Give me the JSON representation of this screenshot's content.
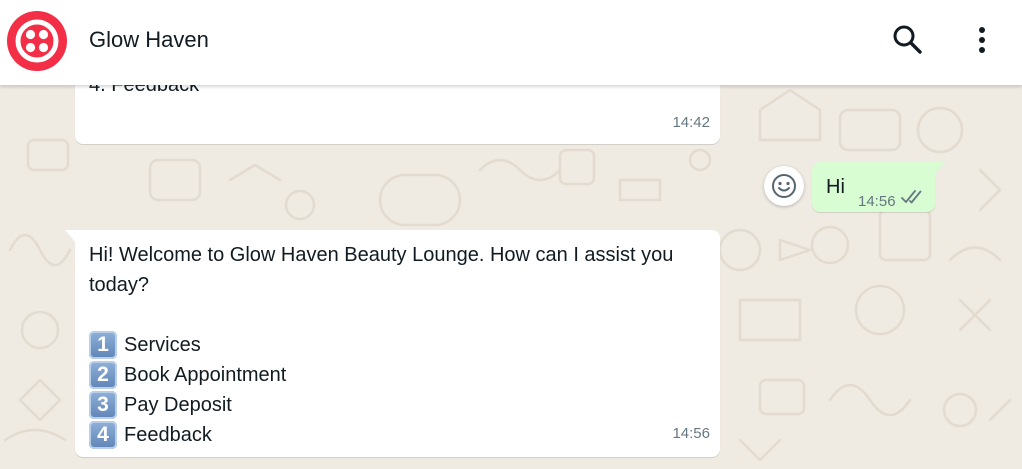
{
  "header": {
    "contact_name": "Glow Haven",
    "logo_icon": "twilio-logo",
    "search_icon": "search-icon",
    "menu_icon": "more-vertical-icon"
  },
  "messages": [
    {
      "direction": "incoming",
      "partial_text": "4. Feedback",
      "time": "14:42"
    },
    {
      "direction": "outgoing",
      "text": "Hi",
      "time": "14:56",
      "status": "read",
      "status_icon": "double-check-icon"
    },
    {
      "direction": "incoming",
      "text": "Hi! Welcome to Glow Haven Beauty Lounge. How can I assist you today?",
      "options": [
        {
          "key": "1",
          "label": "Services"
        },
        {
          "key": "2",
          "label": "Book Appointment"
        },
        {
          "key": "3",
          "label": "Pay Deposit"
        },
        {
          "key": "4",
          "label": "Feedback"
        }
      ],
      "time": "14:56"
    }
  ],
  "reaction_icon": "emoji-smile-icon",
  "colors": {
    "wallpaper": "#efeae2",
    "incoming_bubble": "#ffffff",
    "outgoing_bubble": "#d9fdd3",
    "logo_red": "#f22f46",
    "read_ticks": "#667781"
  }
}
